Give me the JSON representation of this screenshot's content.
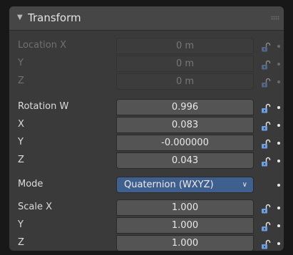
{
  "panel": {
    "title": "Transform",
    "collapsed": false
  },
  "location": {
    "disabled": true,
    "rows": [
      {
        "label": "Location X",
        "value": "0 m"
      },
      {
        "label": "Y",
        "value": "0 m"
      },
      {
        "label": "Z",
        "value": "0 m"
      }
    ]
  },
  "rotation": {
    "rows": [
      {
        "label": "Rotation W",
        "value": "0.996"
      },
      {
        "label": "X",
        "value": "0.083"
      },
      {
        "label": "Y",
        "value": "-0.000000"
      },
      {
        "label": "Z",
        "value": "0.043"
      }
    ]
  },
  "mode": {
    "label": "Mode",
    "selected": "Quaternion (WXYZ)"
  },
  "scale": {
    "rows": [
      {
        "label": "Scale X",
        "value": "1.000"
      },
      {
        "label": "Y",
        "value": "1.000"
      },
      {
        "label": "Z",
        "value": "1.000"
      }
    ]
  },
  "icons": {
    "lock": "lock-open-icon",
    "keyframe": "keyframe-dot-icon",
    "collapse": "disclosure-triangle-icon",
    "grip": "drag-grip-icon"
  },
  "colors": {
    "panel_bg": "#3a3a3a",
    "field_bg": "#545454",
    "select_bg": "#3f5f8f",
    "lock_blue": "#6f9fe0"
  }
}
